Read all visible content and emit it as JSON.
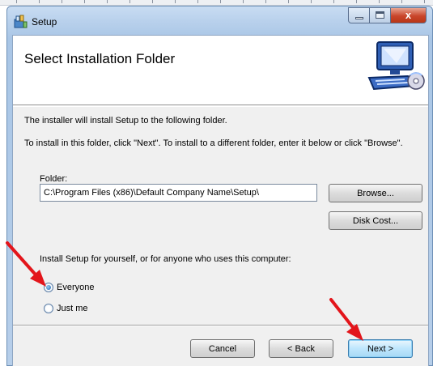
{
  "window": {
    "title": "Setup",
    "app_icon": "setup-package-icon",
    "caption_buttons": {
      "minimize": "minimize-icon",
      "maximize": "maximize-icon",
      "close_label": "x"
    }
  },
  "banner": {
    "title": "Select Installation Folder",
    "icon": "computer-cd-icon"
  },
  "body": {
    "line1": "The installer will install Setup to the following folder.",
    "line2": "To install in this folder, click \"Next\". To install to a different folder, enter it below or click \"Browse\".",
    "folder_label": "Folder:",
    "folder_value": "C:\\Program Files (x86)\\Default Company Name\\Setup\\",
    "browse_label": "Browse...",
    "disk_cost_label": "Disk Cost...",
    "install_for_label": "Install Setup for yourself, or for anyone who uses this computer:",
    "options": [
      {
        "label": "Everyone",
        "checked": true
      },
      {
        "label": "Just me",
        "checked": false
      }
    ]
  },
  "footer": {
    "cancel_label": "Cancel",
    "back_label": "< Back",
    "next_label": "Next >"
  },
  "colors": {
    "annotation_arrow": "#e3151b",
    "next_button_border": "#3c7fb1",
    "close_button": "#c9452a"
  }
}
